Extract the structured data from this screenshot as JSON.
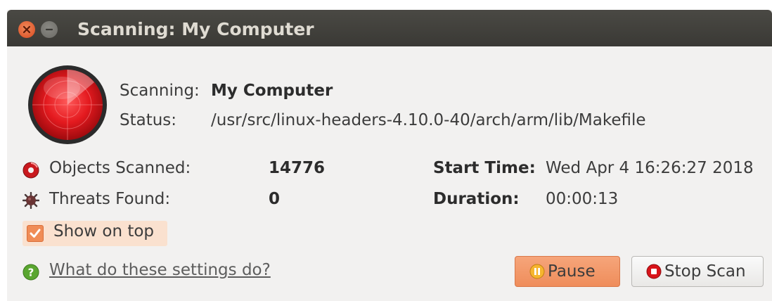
{
  "window": {
    "title": "Scanning: My Computer"
  },
  "scan": {
    "scanning_label": "Scanning:",
    "scanning_value": "My Computer",
    "status_label": "Status:",
    "status_value": "/usr/src/linux-headers-4.10.0-40/arch/arm/lib/Makefile"
  },
  "stats": {
    "objects_label": "Objects Scanned:",
    "objects_value": "14776",
    "threats_label": "Threats Found:",
    "threats_value": "0",
    "start_label": "Start Time:",
    "start_value": "Wed Apr 4 16:26:27 2018",
    "duration_label": "Duration:",
    "duration_value": "00:00:13"
  },
  "options": {
    "show_on_top_label": "Show on top",
    "show_on_top_checked": true
  },
  "footer": {
    "help_link": "What do these settings do?",
    "pause_label": "Pause",
    "stop_label": "Stop Scan"
  },
  "icons": {
    "close": "close-icon",
    "minimize": "minimize-icon",
    "radar": "radar-icon",
    "objects": "disc-icon",
    "threats": "virus-icon",
    "help": "help-icon",
    "pause": "pause-icon",
    "stop": "stop-icon"
  },
  "colors": {
    "accent": "#f08c56",
    "radar_red": "#d8141a",
    "titlebar": "#3c3b37"
  }
}
